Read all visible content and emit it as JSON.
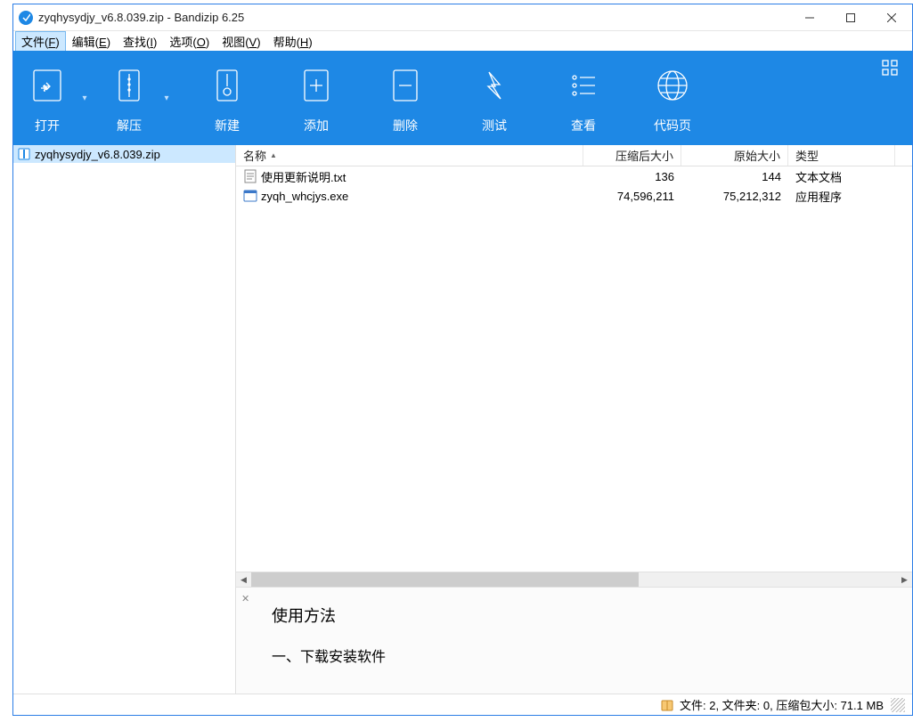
{
  "titlebar": {
    "title": "zyqhysydjy_v6.8.039.zip - Bandizip 6.25"
  },
  "menu": {
    "file": {
      "label": "文件",
      "key": "F"
    },
    "edit": {
      "label": "编辑",
      "key": "E"
    },
    "find": {
      "label": "查找",
      "key": "I"
    },
    "options": {
      "label": "选项",
      "key": "O"
    },
    "view": {
      "label": "视图",
      "key": "V"
    },
    "help": {
      "label": "帮助",
      "key": "H"
    }
  },
  "toolbar": {
    "open": "打开",
    "extract": "解压",
    "new": "新建",
    "add": "添加",
    "delete": "删除",
    "test": "测试",
    "view": "查看",
    "codepage": "代码页"
  },
  "tree": {
    "root": "zyqhysydjy_v6.8.039.zip"
  },
  "columns": {
    "name": "名称",
    "compressed": "压缩后大小",
    "original": "原始大小",
    "type": "类型"
  },
  "files": [
    {
      "name": "使用更新说明.txt",
      "compressed": "136",
      "original": "144",
      "type": "文本文档",
      "icon": "txt"
    },
    {
      "name": "zyqh_whcjys.exe",
      "compressed": "74,596,211",
      "original": "75,212,312",
      "type": "应用程序",
      "icon": "exe"
    }
  ],
  "preview": {
    "heading1": "使用方法",
    "heading2": "一、下载安装软件"
  },
  "status": {
    "text": "文件: 2, 文件夹: 0, 压缩包大小: 71.1 MB"
  }
}
